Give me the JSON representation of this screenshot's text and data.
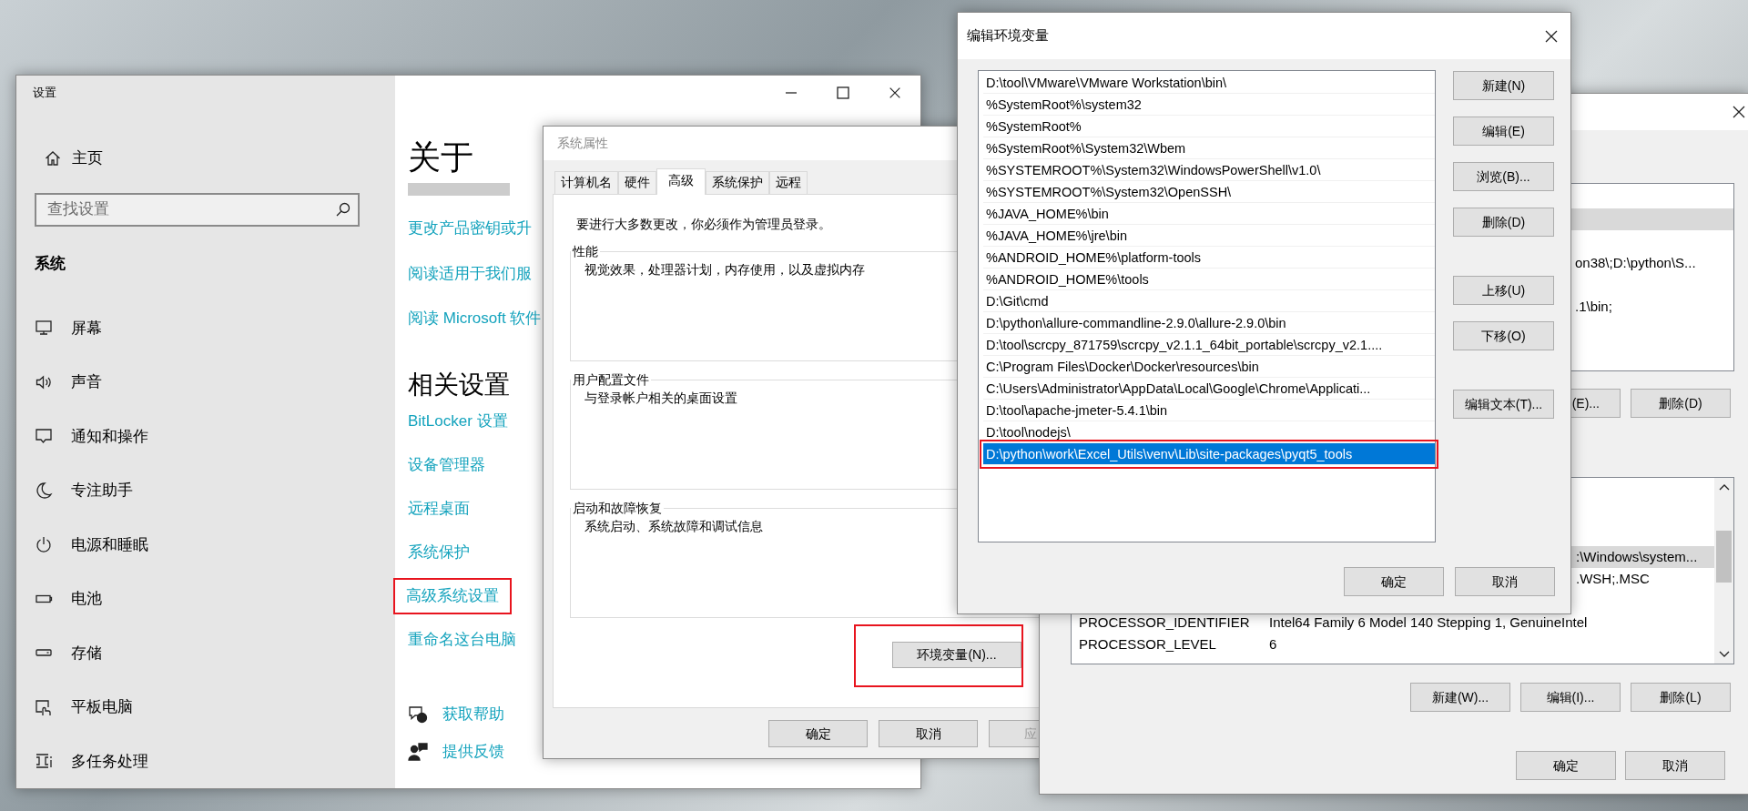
{
  "settings_window": {
    "title": "设置",
    "home": "主页",
    "search": {
      "placeholder": "查找设置"
    },
    "section_title": "系统",
    "nav_items": [
      {
        "label": "屏幕"
      },
      {
        "label": "声音"
      },
      {
        "label": "通知和操作"
      },
      {
        "label": "专注助手"
      },
      {
        "label": "电源和睡眠"
      },
      {
        "label": "电池"
      },
      {
        "label": "存储"
      },
      {
        "label": "平板电脑"
      },
      {
        "label": "多任务处理"
      }
    ],
    "page_title": "关于",
    "links": [
      "更改产品密钥或升",
      "阅读适用于我们服",
      "阅读 Microsoft 软件"
    ],
    "related_title": "相关设置",
    "related_links": [
      {
        "label": "BitLocker 设置",
        "highlighted": false
      },
      {
        "label": "设备管理器",
        "highlighted": false
      },
      {
        "label": "远程桌面",
        "highlighted": false
      },
      {
        "label": "系统保护",
        "highlighted": false
      },
      {
        "label": "高级系统设置",
        "highlighted": true
      },
      {
        "label": "重命名这台电脑",
        "highlighted": false
      }
    ],
    "help_links": [
      "获取帮助",
      "提供反馈"
    ]
  },
  "system_properties": {
    "title": "系统属性",
    "tabs": [
      {
        "label": "计算机名",
        "selected": false
      },
      {
        "label": "硬件",
        "selected": false
      },
      {
        "label": "高级",
        "selected": true
      },
      {
        "label": "系统保护",
        "selected": false
      },
      {
        "label": "远程",
        "selected": false
      }
    ],
    "admin_note": "要进行大多数更改，你必须作为管理员登录。",
    "groups": [
      {
        "title": "性能",
        "description": "视觉效果，处理器计划，内存使用，以及虚拟内存"
      },
      {
        "title": "用户配置文件",
        "description": "与登录帐户相关的桌面设置"
      },
      {
        "title": "启动和故障恢复",
        "description": "系统启动、系统故障和调试信息"
      }
    ],
    "env_button": {
      "label": "环境变量(N)...",
      "highlighted": true
    },
    "buttons": [
      {
        "label": "确定",
        "disabled": false
      },
      {
        "label": "取消",
        "disabled": false
      },
      {
        "label": "应",
        "disabled": true
      }
    ]
  },
  "environment_variables": {
    "user_rows": [
      {
        "selected": false
      },
      {
        "selected": true
      },
      {
        "selected": false
      },
      {
        "value": "on38\\;D:\\python\\S...",
        "selected": false
      },
      {
        "selected": false
      },
      {
        "value": ".1\\bin;",
        "selected": false
      },
      {
        "selected": false
      },
      {
        "selected": false
      }
    ],
    "user_buttons": [
      "(E)...",
      "删除(D)"
    ],
    "system_rows": [
      {
        "selected": false
      },
      {
        "selected": false
      },
      {
        "selected": false
      },
      {
        "value": ":\\Windows\\system...",
        "cut_left": true,
        "selected": true
      },
      {
        "value": ".WSH;.MSC",
        "cut_left": true,
        "selected": false
      },
      {
        "selected": false
      },
      {
        "name": "PROCESSOR_IDENTIFIER",
        "value": "Intel64 Family 6 Model 140 Stepping 1, GenuineIntel",
        "selected": false
      },
      {
        "name": "PROCESSOR_LEVEL",
        "value": "6",
        "selected": false
      }
    ],
    "system_buttons": [
      "新建(W)...",
      "编辑(I)...",
      "删除(L)"
    ],
    "buttons": [
      "确定",
      "取消"
    ]
  },
  "edit_dialog": {
    "title": "编辑环境变量",
    "entries": [
      {
        "text": "D:\\tool\\VMware\\VMware Workstation\\bin\\",
        "selected": false,
        "highlighted": false
      },
      {
        "text": "%SystemRoot%\\system32",
        "selected": false,
        "highlighted": false
      },
      {
        "text": "%SystemRoot%",
        "selected": false,
        "highlighted": false
      },
      {
        "text": "%SystemRoot%\\System32\\Wbem",
        "selected": false,
        "highlighted": false
      },
      {
        "text": "%SYSTEMROOT%\\System32\\WindowsPowerShell\\v1.0\\",
        "selected": false,
        "highlighted": false
      },
      {
        "text": "%SYSTEMROOT%\\System32\\OpenSSH\\",
        "selected": false,
        "highlighted": false
      },
      {
        "text": "%JAVA_HOME%\\bin",
        "selected": false,
        "highlighted": false
      },
      {
        "text": "%JAVA_HOME%\\jre\\bin",
        "selected": false,
        "highlighted": false
      },
      {
        "text": "%ANDROID_HOME%\\platform-tools",
        "selected": false,
        "highlighted": false
      },
      {
        "text": "%ANDROID_HOME%\\tools",
        "selected": false,
        "highlighted": false
      },
      {
        "text": "D:\\Git\\cmd",
        "selected": false,
        "highlighted": false
      },
      {
        "text": "D:\\python\\allure-commandline-2.9.0\\allure-2.9.0\\bin",
        "selected": false,
        "highlighted": false
      },
      {
        "text": "D:\\tool\\scrcpy_871759\\scrcpy_v2.1.1_64bit_portable\\scrcpy_v2.1....",
        "selected": false,
        "highlighted": false
      },
      {
        "text": "C:\\Program Files\\Docker\\Docker\\resources\\bin",
        "selected": false,
        "highlighted": false
      },
      {
        "text": "C:\\Users\\Administrator\\AppData\\Local\\Google\\Chrome\\Applicati...",
        "selected": false,
        "highlighted": false
      },
      {
        "text": "D:\\tool\\apache-jmeter-5.4.1\\bin",
        "selected": false,
        "highlighted": false
      },
      {
        "text": "D:\\tool\\nodejs\\",
        "selected": false,
        "highlighted": false
      },
      {
        "text": "D:\\python\\work\\Excel_Utils\\venv\\Lib\\site-packages\\pyqt5_tools",
        "selected": true,
        "highlighted": true
      }
    ],
    "button_groups": [
      [
        "新建(N)",
        "编辑(E)",
        "浏览(B)...",
        "删除(D)"
      ],
      [
        "上移(U)",
        "下移(O)"
      ],
      [
        "编辑文本(T)..."
      ]
    ],
    "buttons": [
      "确定",
      "取消"
    ]
  }
}
